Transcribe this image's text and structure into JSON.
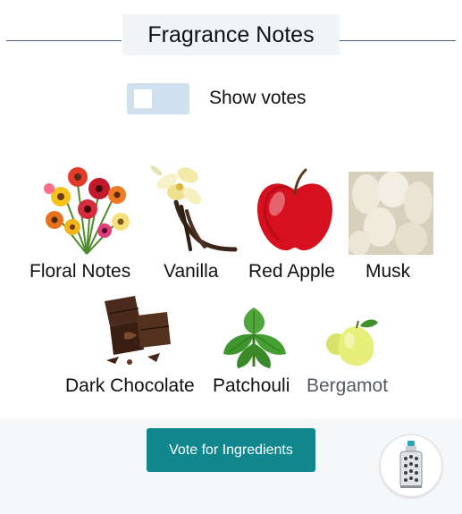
{
  "header": {
    "title": "Fragrance Notes"
  },
  "toggle": {
    "label": "Show votes",
    "checked": false
  },
  "notes": [
    {
      "label": "Floral Notes",
      "icon": "flowers-icon"
    },
    {
      "label": "Vanilla",
      "icon": "vanilla-icon"
    },
    {
      "label": "Red Apple",
      "icon": "apple-icon"
    },
    {
      "label": "Musk",
      "icon": "musk-icon"
    },
    {
      "label": "Dark Chocolate",
      "icon": "chocolate-icon"
    },
    {
      "label": "Patchouli",
      "icon": "patchouli-icon"
    },
    {
      "label": "Bergamot",
      "icon": "bergamot-icon"
    }
  ],
  "vote": {
    "label": "Vote for Ingredients"
  },
  "colors": {
    "accent": "#10868d",
    "toggle_track": "#cfe0ef",
    "muted_label": "#555a60"
  }
}
